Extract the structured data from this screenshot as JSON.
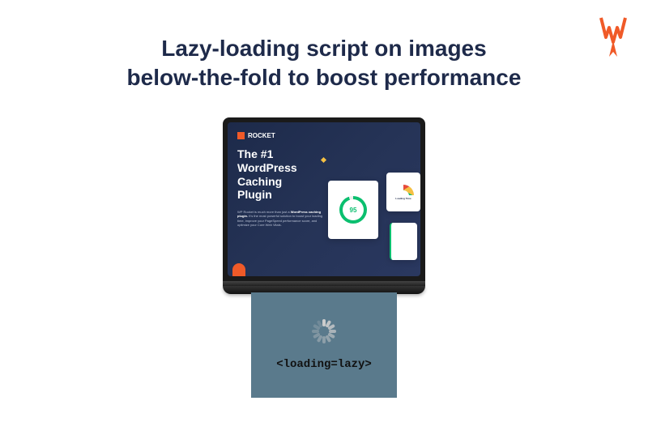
{
  "title_line1": "Lazy-loading script on images",
  "title_line2": "below-the-fold to boost performance",
  "screen": {
    "brand": "ROCKET",
    "hero_title": "The #1 WordPress Caching Plugin",
    "hero_para_prefix": "WP Rocket is much more than just a ",
    "hero_para_bold": "WordPress caching plugin.",
    "hero_para_suffix": " It's the most powerful solution to boost your loading time, improve your PageSpeed performance score, and optimize your Core Web Vitals.",
    "score": "95",
    "card2_label": "Loading Time"
  },
  "belowfold_code": "<loading=lazy>"
}
